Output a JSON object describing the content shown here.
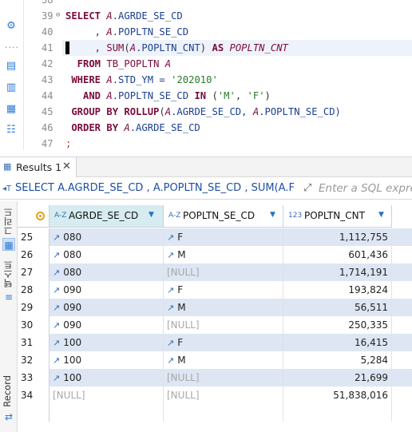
{
  "editor": {
    "line_numbers": [
      "38",
      "39",
      "40",
      "41",
      "42",
      "43",
      "44",
      "45",
      "46",
      "47"
    ],
    "code_lines": [
      [
        {
          "t": "SELECT ",
          "c": "kw"
        },
        {
          "t": "A",
          "c": "al"
        },
        {
          "t": ".AGRDE_SE_CD",
          "c": "id"
        }
      ],
      [
        {
          "t": "     , ",
          "c": "op"
        },
        {
          "t": "A",
          "c": "al"
        },
        {
          "t": ".POPLTN_SE_CD",
          "c": "id"
        }
      ],
      [
        {
          "t": "     , ",
          "c": "op"
        },
        {
          "t": "SUM",
          "c": "fn"
        },
        {
          "t": "(",
          "c": "op"
        },
        {
          "t": "A",
          "c": "al"
        },
        {
          "t": ".POPLTN_CNT",
          "c": "id"
        },
        {
          "t": ") ",
          "c": "op"
        },
        {
          "t": "AS ",
          "c": "kw"
        },
        {
          "t": "POPLTN_CNT",
          "c": "al"
        }
      ],
      [
        {
          "t": "  FROM ",
          "c": "kw"
        },
        {
          "t": "TB_POPLTN ",
          "c": "fn"
        },
        {
          "t": "A",
          "c": "al"
        }
      ],
      [
        {
          "t": " WHERE ",
          "c": "kw"
        },
        {
          "t": "A",
          "c": "al"
        },
        {
          "t": ".STD_YM = ",
          "c": "id"
        },
        {
          "t": "'202010'",
          "c": "str"
        }
      ],
      [
        {
          "t": "   AND ",
          "c": "kw"
        },
        {
          "t": "A",
          "c": "al"
        },
        {
          "t": ".POPLTN_SE_CD ",
          "c": "id"
        },
        {
          "t": "IN ",
          "c": "kw"
        },
        {
          "t": "(",
          "c": "op"
        },
        {
          "t": "'M'",
          "c": "str"
        },
        {
          "t": ", ",
          "c": "op"
        },
        {
          "t": "'F'",
          "c": "str"
        },
        {
          "t": ")",
          "c": "op"
        }
      ],
      [
        {
          "t": " GROUP BY ",
          "c": "kw"
        },
        {
          "t": "ROLLUP",
          "c": "kw"
        },
        {
          "t": "(",
          "c": "op"
        },
        {
          "t": "A",
          "c": "al"
        },
        {
          "t": ".AGRDE_SE_CD, ",
          "c": "id"
        },
        {
          "t": "A",
          "c": "al"
        },
        {
          "t": ".POPLTN_SE_CD)",
          "c": "id"
        }
      ],
      [
        {
          "t": " ORDER BY ",
          "c": "kw"
        },
        {
          "t": "A",
          "c": "al"
        },
        {
          "t": ".AGRDE_SE_CD",
          "c": "id"
        }
      ],
      [
        {
          "t": ";",
          "c": "semi"
        }
      ]
    ]
  },
  "results_tab": {
    "label": "Results 1",
    "close": "✕"
  },
  "filter": {
    "query_text": "SELECT A.AGRDE_SE_CD , A.POPLTN_SE_CD , SUM(A.F",
    "placeholder": "Enter a SQL expres"
  },
  "side_toolbar": {
    "grid_label": "그리드",
    "text_label": "텍스트",
    "record_label": "Record"
  },
  "columns": [
    {
      "type_icon": "A-Z",
      "name": "AGRDE_SE_CD"
    },
    {
      "type_icon": "A-Z",
      "name": "POPLTN_SE_CD"
    },
    {
      "type_icon": "123",
      "name": "POPLTN_CNT"
    }
  ],
  "rows": [
    {
      "n": "25",
      "agrde": "080",
      "popltn": "F",
      "cnt": "1,112,755"
    },
    {
      "n": "26",
      "agrde": "080",
      "popltn": "M",
      "cnt": "601,436"
    },
    {
      "n": "27",
      "agrde": "080",
      "popltn": "[NULL]",
      "cnt": "1,714,191"
    },
    {
      "n": "28",
      "agrde": "090",
      "popltn": "F",
      "cnt": "193,824"
    },
    {
      "n": "29",
      "agrde": "090",
      "popltn": "M",
      "cnt": "56,511"
    },
    {
      "n": "30",
      "agrde": "090",
      "popltn": "[NULL]",
      "cnt": "250,335"
    },
    {
      "n": "31",
      "agrde": "100",
      "popltn": "F",
      "cnt": "16,415"
    },
    {
      "n": "32",
      "agrde": "100",
      "popltn": "M",
      "cnt": "5,284"
    },
    {
      "n": "33",
      "agrde": "100",
      "popltn": "[NULL]",
      "cnt": "21,699"
    },
    {
      "n": "34",
      "agrde": "[NULL]",
      "popltn": "[NULL]",
      "cnt": "51,838,016"
    }
  ]
}
